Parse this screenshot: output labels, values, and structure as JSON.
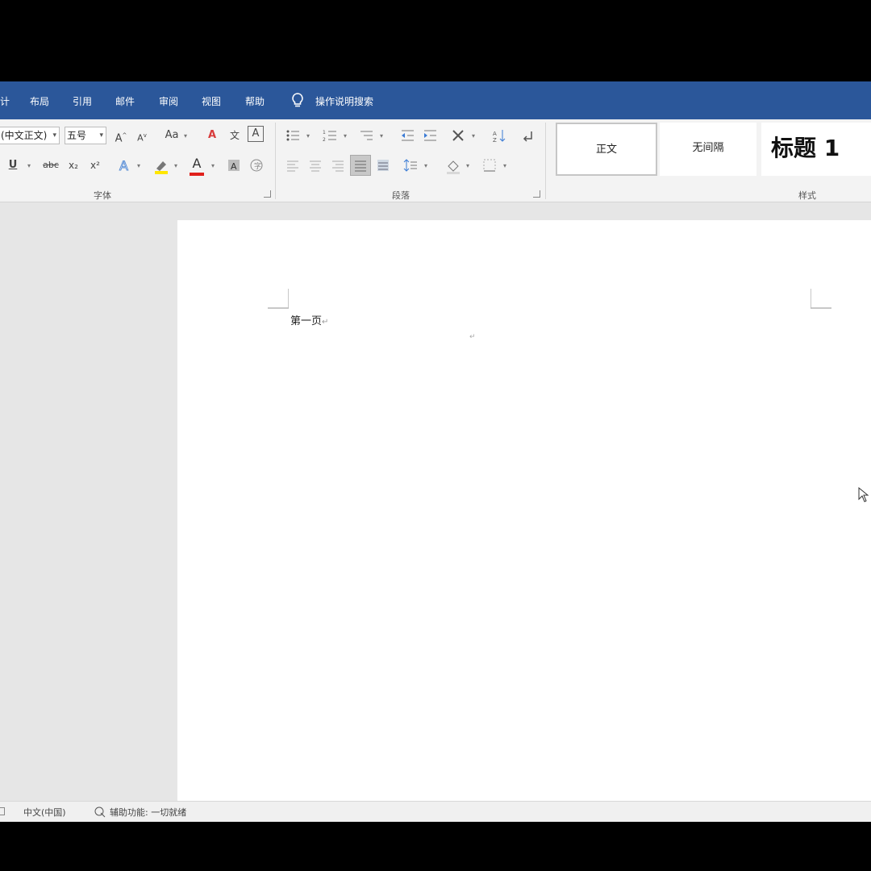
{
  "menu": {
    "items": [
      "计",
      "布局",
      "引用",
      "邮件",
      "审阅",
      "视图",
      "帮助"
    ],
    "tell_me": "操作说明搜索"
  },
  "ribbon": {
    "font": {
      "font_name": "(中文正文)",
      "font_size": "五号",
      "group_label": "字体",
      "change_case": "Aa",
      "grow": "A",
      "shrink": "A",
      "underline": "U",
      "strikethrough": "abc",
      "subscript": "x₂",
      "superscript": "x²",
      "font_color": "A",
      "char_border": "A",
      "phonetic": "文",
      "clear_format": "A",
      "colors": {
        "highlight": "#ffe600",
        "font_color": "#e0201b",
        "clear_icon": "#d83b3b"
      }
    },
    "paragraph": {
      "group_label": "段落"
    },
    "styles": {
      "group_label": "样式",
      "items": [
        "正文",
        "无间隔",
        "标题 1"
      ]
    }
  },
  "document": {
    "text": "第一页",
    "paragraph_mark": "↵",
    "eol_mark": "↵"
  },
  "status": {
    "language": "中文(中国)",
    "accessibility": "辅助功能: 一切就绪"
  },
  "colors": {
    "menubar": "#2b579a",
    "ribbon": "#f3f3f3",
    "canvas": "#e6e6e6"
  }
}
